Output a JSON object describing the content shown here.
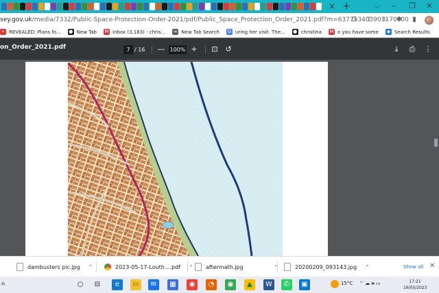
{
  "browser": {
    "tab_close": "×",
    "new_tab": "+",
    "window_controls": {
      "minimize": "⌵",
      "restore": "–",
      "maximize": "❐",
      "close": "✕"
    },
    "tab_icon_colors": [
      "#2c6fb5",
      "#e05a2b",
      "#3a8f3d",
      "#1a1a1a",
      "#d93c3c",
      "#2c6fb5",
      "#e6a21a",
      "#ffffff",
      "#7a3fb0",
      "#2a9d8f",
      "#1a1a1a",
      "#d93c3c",
      "#2c6fb5",
      "#3a8f3d",
      "#e05a2b",
      "#ffffff",
      "#2c6fb5",
      "#1a1a1a",
      "#e6a21a",
      "#2a9d8f",
      "#d93c3c",
      "#7a3fb0",
      "#3a8f3d",
      "#2c6fb5",
      "#ffffff",
      "#e05a2b",
      "#1a1a1a",
      "#2c6fb5",
      "#d93c3c",
      "#3a8f3d",
      "#e6a21a",
      "#2a9d8f",
      "#7a3fb0",
      "#ffffff",
      "#2c6fb5",
      "#1a1a1a",
      "#d93c3c",
      "#e05a2b",
      "#3a8f3d",
      "#2c6fb5",
      "#e6a21a",
      "#ffffff",
      "#2a9d8f",
      "#d93c3c",
      "#1a1a1a",
      "#2c6fb5",
      "#7a3fb0",
      "#3a8f3d",
      "#e05a2b",
      "#2c6fb5",
      "#d93c3c",
      "#ffffff"
    ]
  },
  "address": {
    "domain": "sey.gov.uk",
    "path": "/media/7332/Public-Space-Protection-Order-2021/pdf/Public_Space_Protection_Order_2021.pdf?m=637753403903170000",
    "icons": {
      "google": "G",
      "share": "⇪",
      "star": "☆",
      "extensions": "✱",
      "sidebar": "▮"
    }
  },
  "bookmarks": [
    {
      "label": "REVEALED: Plans fo...",
      "icon_color": "#d93c3c",
      "glyph": "•"
    },
    {
      "label": "New Tab",
      "icon_color": "#202124",
      "glyph": "●"
    },
    {
      "label": "Inbox (3,183) - chris...",
      "icon_color": "#d93c3c",
      "glyph": "M"
    },
    {
      "label": "New Tab Search",
      "icon_color": "#5f6368",
      "glyph": "∞"
    },
    {
      "label": "uring her visit. The...",
      "icon_color": "#4285f4",
      "glyph": "G"
    },
    {
      "label": "christina",
      "icon_color": "#202124",
      "glyph": "●"
    },
    {
      "label": "o you have some",
      "icon_color": "#d93c3c",
      "glyph": "M"
    },
    {
      "label": "Search Results",
      "icon_color": "#1a73e8",
      "glyph": "◆"
    }
  ],
  "pdf": {
    "title": "on_Order_2021.pdf",
    "page_current": "7",
    "page_total": "/ 16",
    "zoom": "100%",
    "zoom_out": "—",
    "zoom_in": "+",
    "fit_icon": "⊡",
    "rotate_icon": "↺",
    "download_icon": "⤓",
    "print_icon": "⎙",
    "more_icon": "⋮"
  },
  "downloads": {
    "items": [
      {
        "name": "dambusters pic.jpg",
        "type": "file"
      },
      {
        "name": "2023-05-17-Louth....pdf",
        "type": "chrome"
      },
      {
        "name": "aftermath.jpg",
        "type": "file"
      },
      {
        "name": "20200209_093143.jpg",
        "type": "file"
      }
    ],
    "chevron": "⌃",
    "show_all": "Show all",
    "close": "✕"
  },
  "taskbar": {
    "weather": "15°C",
    "time": "17:21",
    "date": "16/05/2023",
    "tray_icons": "⌃ ☁ 🕪 ▭",
    "apps": [
      {
        "name": "start",
        "glyph": "○",
        "color": "transparent",
        "fg": "#202124"
      },
      {
        "name": "task-view",
        "glyph": "⊟",
        "color": "transparent",
        "fg": "#202124"
      },
      {
        "name": "edge",
        "glyph": "e",
        "color": "#0c7bd1",
        "fg": "#fff"
      },
      {
        "name": "explorer",
        "glyph": "▭",
        "color": "#f2c230",
        "fg": "#7a5a00"
      },
      {
        "name": "mail",
        "glyph": "✉",
        "color": "#1a73e8",
        "fg": "#fff"
      },
      {
        "name": "store",
        "glyph": "▦",
        "color": "#3b6fd8",
        "fg": "#fff"
      },
      {
        "name": "chrome",
        "glyph": "◉",
        "color": "#ea4335",
        "fg": "#fff"
      },
      {
        "name": "firefox",
        "glyph": "◔",
        "color": "#e66000",
        "fg": "#fff"
      },
      {
        "name": "chrome-active",
        "glyph": "◉",
        "color": "#34a853",
        "fg": "#fff"
      },
      {
        "name": "drive",
        "glyph": "▲",
        "color": "#fbbc04",
        "fg": "#188038"
      },
      {
        "name": "word",
        "glyph": "W",
        "color": "#2b579a",
        "fg": "#fff"
      },
      {
        "name": "whatsapp",
        "glyph": "✆",
        "color": "#25d366",
        "fg": "#fff"
      },
      {
        "name": "photos",
        "glyph": "▣",
        "color": "#0078d4",
        "fg": "#fff"
      }
    ]
  }
}
